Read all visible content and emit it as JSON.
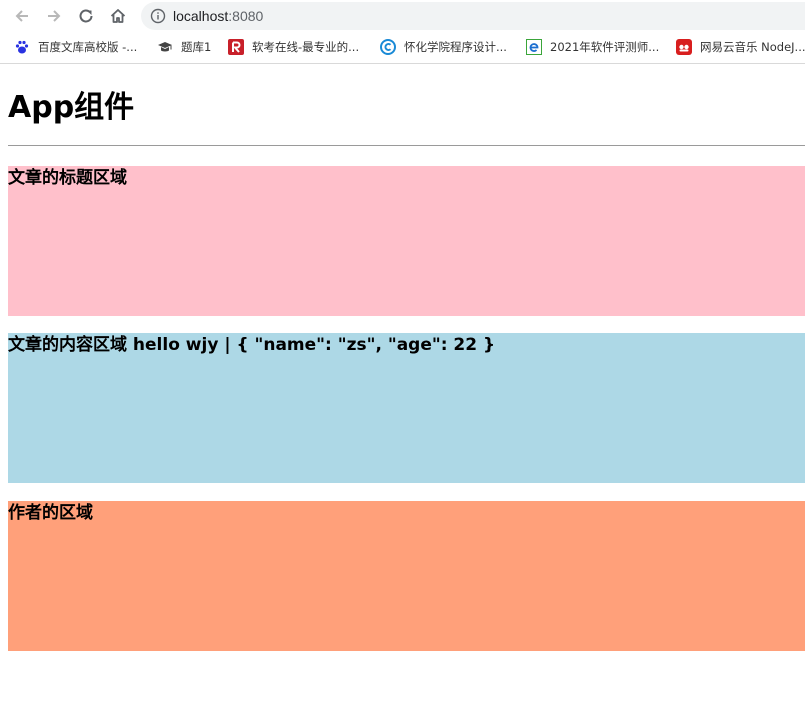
{
  "browser": {
    "url_host": "localhost",
    "url_port": ":8080",
    "bookmarks": [
      {
        "label": "百度文库高校版 -...",
        "icon": "baidu-paw-icon"
      },
      {
        "label": "题库1",
        "icon": "graduation-cap-icon"
      },
      {
        "label": "软考在线-最专业的...",
        "icon": "r-logo-icon"
      },
      {
        "label": "怀化学院程序设计...",
        "icon": "c-logo-icon"
      },
      {
        "label": "2021年软件评测师...",
        "icon": "ie-logo-icon"
      },
      {
        "label": "网易云音乐 NodeJ...",
        "icon": "netease-music-icon"
      }
    ]
  },
  "app": {
    "title": "App组件",
    "article_title_label": "文章的标题区域",
    "article_content_label": "文章的内容区域 hello wjy | { \"name\": \"zs\", \"age\": 22 }",
    "author_label": "作者的区域"
  },
  "colors": {
    "title_area": "#ffc0cb",
    "content_area": "#add8e6",
    "author_area": "#ffa07a"
  }
}
